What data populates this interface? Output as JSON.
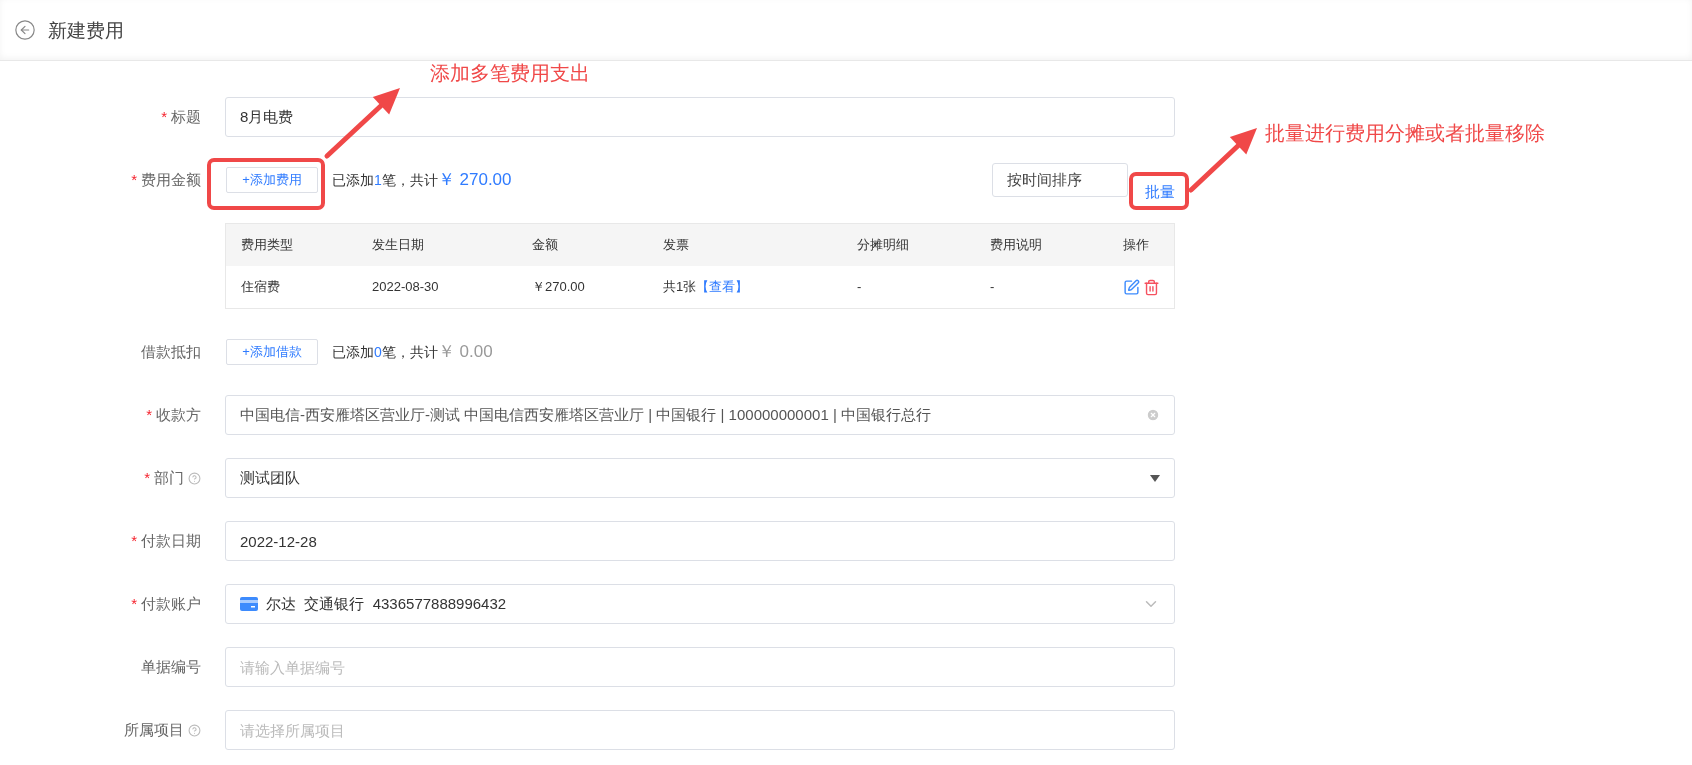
{
  "header": {
    "title": "新建费用"
  },
  "fields": [
    {
      "kind": "input",
      "label": "标题",
      "mark": "*",
      "value": "8月电费"
    },
    {
      "kind": "list",
      "label": "费用金额",
      "mark": "*",
      "button": "+添加费用",
      "summary": {
        "prefix": "已添加",
        "count": "1",
        "middle": "笔，共计",
        "amount": "￥ 270.00",
        "highlight": true
      },
      "sort": "按时间排序",
      "batch": "批量",
      "table": {
        "columns": [
          "费用类型",
          "发生日期",
          "金额",
          "发票",
          "分摊明细",
          "费用说明",
          "操作"
        ],
        "rows": [
          {
            "type": "住宿费",
            "date": "2022-08-30",
            "amount": "￥270.00",
            "invoice": "共1张",
            "invoice_link": "【查看】",
            "split": "-",
            "note": "-"
          }
        ]
      }
    },
    {
      "kind": "list",
      "label": "借款抵扣",
      "button": "+添加借款",
      "summary": {
        "prefix": "已添加",
        "count": "0",
        "middle": "笔，共计",
        "amount": "￥ 0.00",
        "highlight": false
      }
    },
    {
      "kind": "clearable",
      "label": "收款方",
      "mark": "*",
      "value": "中国电信-西安雁塔区营业厅-测试 中国电信西安雁塔区营业厅 | 中国银行 | 100000000001 | 中国银行总行"
    },
    {
      "kind": "select",
      "label": "部门",
      "mark": "*",
      "help": true,
      "value": "测试团队"
    },
    {
      "kind": "input",
      "label": "付款日期",
      "mark": "*",
      "value": "2022-12-28"
    },
    {
      "kind": "combobox",
      "label": "付款账户",
      "mark": "*",
      "card": true,
      "value": "尔达  交通银行  4336577888996432"
    },
    {
      "kind": "input",
      "label": "单据编号",
      "placeholder": "请输入单据编号"
    },
    {
      "kind": "input",
      "label": "所属项目",
      "help": true,
      "placeholder": "请选择所属项目"
    }
  ],
  "annotations": [
    {
      "text": "添加多笔费用支出"
    },
    {
      "text": "批量进行费用分摊或者批量移除"
    }
  ]
}
